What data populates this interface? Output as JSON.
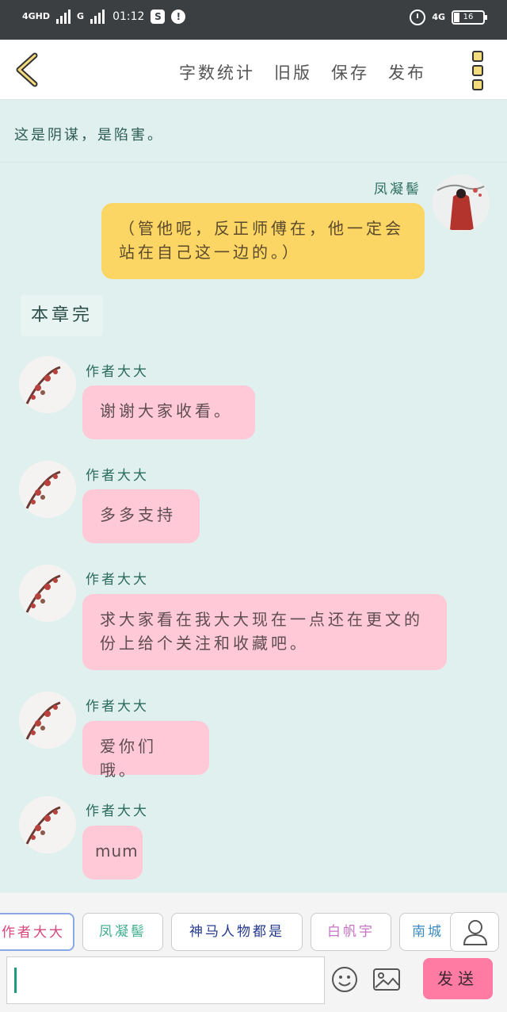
{
  "status_bar": {
    "network_1": "4GHD",
    "network_2": "G",
    "time": "01:12",
    "app_icon_1": "S",
    "app_icon_2": "!",
    "network_right": "4G",
    "battery": "16",
    "icons": [
      "signal-icon",
      "signal-icon",
      "alarm-icon",
      "battery-icon"
    ]
  },
  "toolbar": {
    "word_count": "字数统计",
    "old_version": "旧版",
    "save": "保存",
    "publish": "发布",
    "back_icon": "chevron-left-icon",
    "menu_icon": "more-icon"
  },
  "notice": "这是阴谋，是陷害。",
  "messages": [
    {
      "name": "凤凝髻",
      "text": "（管他呢，反正师傅在，他一定会站在自己这一边的。）",
      "color": "#fbd665"
    },
    {
      "name": "作者大大",
      "text": "谢谢大家收看。",
      "color": "#ffc9d7"
    },
    {
      "name": "作者大大",
      "text": "多多支持",
      "color": "#ffc9d7"
    },
    {
      "name": "作者大大",
      "text": "求大家看在我大大现在一点还在更文的份上给个关注和收藏吧。",
      "color": "#ffc9d7"
    },
    {
      "name": "作者大大",
      "text": "爱你们哦。",
      "color": "#ffc9d7"
    },
    {
      "name": "作者大大",
      "text": "mum",
      "color": "#ffc9d7"
    }
  ],
  "chapter_end": "本章完",
  "roles": [
    {
      "label": "作者大大",
      "color": "#d9467a"
    },
    {
      "label": "凤凝髻",
      "color": "#3fae8e"
    },
    {
      "label": "神马人物都是",
      "color": "#253a8e"
    },
    {
      "label": "白帆宇",
      "color": "#c773c4"
    },
    {
      "label": "南城",
      "color": "#3c8bbf"
    }
  ],
  "input": {
    "value": "",
    "placeholder": ""
  },
  "send": "发送"
}
